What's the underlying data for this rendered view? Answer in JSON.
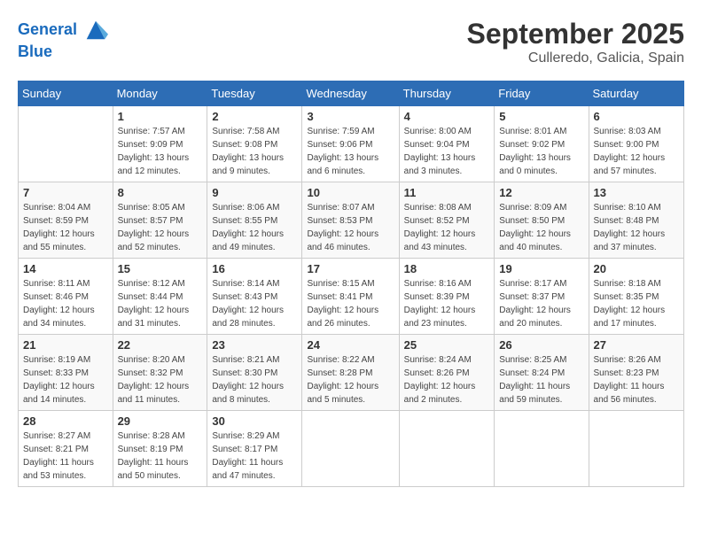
{
  "header": {
    "logo_line1": "General",
    "logo_line2": "Blue",
    "month": "September 2025",
    "location": "Culleredo, Galicia, Spain"
  },
  "weekdays": [
    "Sunday",
    "Monday",
    "Tuesday",
    "Wednesday",
    "Thursday",
    "Friday",
    "Saturday"
  ],
  "weeks": [
    [
      {
        "day": null,
        "info": null
      },
      {
        "day": "1",
        "info": "Sunrise: 7:57 AM\nSunset: 9:09 PM\nDaylight: 13 hours\nand 12 minutes."
      },
      {
        "day": "2",
        "info": "Sunrise: 7:58 AM\nSunset: 9:08 PM\nDaylight: 13 hours\nand 9 minutes."
      },
      {
        "day": "3",
        "info": "Sunrise: 7:59 AM\nSunset: 9:06 PM\nDaylight: 13 hours\nand 6 minutes."
      },
      {
        "day": "4",
        "info": "Sunrise: 8:00 AM\nSunset: 9:04 PM\nDaylight: 13 hours\nand 3 minutes."
      },
      {
        "day": "5",
        "info": "Sunrise: 8:01 AM\nSunset: 9:02 PM\nDaylight: 13 hours\nand 0 minutes."
      },
      {
        "day": "6",
        "info": "Sunrise: 8:03 AM\nSunset: 9:00 PM\nDaylight: 12 hours\nand 57 minutes."
      }
    ],
    [
      {
        "day": "7",
        "info": "Sunrise: 8:04 AM\nSunset: 8:59 PM\nDaylight: 12 hours\nand 55 minutes."
      },
      {
        "day": "8",
        "info": "Sunrise: 8:05 AM\nSunset: 8:57 PM\nDaylight: 12 hours\nand 52 minutes."
      },
      {
        "day": "9",
        "info": "Sunrise: 8:06 AM\nSunset: 8:55 PM\nDaylight: 12 hours\nand 49 minutes."
      },
      {
        "day": "10",
        "info": "Sunrise: 8:07 AM\nSunset: 8:53 PM\nDaylight: 12 hours\nand 46 minutes."
      },
      {
        "day": "11",
        "info": "Sunrise: 8:08 AM\nSunset: 8:52 PM\nDaylight: 12 hours\nand 43 minutes."
      },
      {
        "day": "12",
        "info": "Sunrise: 8:09 AM\nSunset: 8:50 PM\nDaylight: 12 hours\nand 40 minutes."
      },
      {
        "day": "13",
        "info": "Sunrise: 8:10 AM\nSunset: 8:48 PM\nDaylight: 12 hours\nand 37 minutes."
      }
    ],
    [
      {
        "day": "14",
        "info": "Sunrise: 8:11 AM\nSunset: 8:46 PM\nDaylight: 12 hours\nand 34 minutes."
      },
      {
        "day": "15",
        "info": "Sunrise: 8:12 AM\nSunset: 8:44 PM\nDaylight: 12 hours\nand 31 minutes."
      },
      {
        "day": "16",
        "info": "Sunrise: 8:14 AM\nSunset: 8:43 PM\nDaylight: 12 hours\nand 28 minutes."
      },
      {
        "day": "17",
        "info": "Sunrise: 8:15 AM\nSunset: 8:41 PM\nDaylight: 12 hours\nand 26 minutes."
      },
      {
        "day": "18",
        "info": "Sunrise: 8:16 AM\nSunset: 8:39 PM\nDaylight: 12 hours\nand 23 minutes."
      },
      {
        "day": "19",
        "info": "Sunrise: 8:17 AM\nSunset: 8:37 PM\nDaylight: 12 hours\nand 20 minutes."
      },
      {
        "day": "20",
        "info": "Sunrise: 8:18 AM\nSunset: 8:35 PM\nDaylight: 12 hours\nand 17 minutes."
      }
    ],
    [
      {
        "day": "21",
        "info": "Sunrise: 8:19 AM\nSunset: 8:33 PM\nDaylight: 12 hours\nand 14 minutes."
      },
      {
        "day": "22",
        "info": "Sunrise: 8:20 AM\nSunset: 8:32 PM\nDaylight: 12 hours\nand 11 minutes."
      },
      {
        "day": "23",
        "info": "Sunrise: 8:21 AM\nSunset: 8:30 PM\nDaylight: 12 hours\nand 8 minutes."
      },
      {
        "day": "24",
        "info": "Sunrise: 8:22 AM\nSunset: 8:28 PM\nDaylight: 12 hours\nand 5 minutes."
      },
      {
        "day": "25",
        "info": "Sunrise: 8:24 AM\nSunset: 8:26 PM\nDaylight: 12 hours\nand 2 minutes."
      },
      {
        "day": "26",
        "info": "Sunrise: 8:25 AM\nSunset: 8:24 PM\nDaylight: 11 hours\nand 59 minutes."
      },
      {
        "day": "27",
        "info": "Sunrise: 8:26 AM\nSunset: 8:23 PM\nDaylight: 11 hours\nand 56 minutes."
      }
    ],
    [
      {
        "day": "28",
        "info": "Sunrise: 8:27 AM\nSunset: 8:21 PM\nDaylight: 11 hours\nand 53 minutes."
      },
      {
        "day": "29",
        "info": "Sunrise: 8:28 AM\nSunset: 8:19 PM\nDaylight: 11 hours\nand 50 minutes."
      },
      {
        "day": "30",
        "info": "Sunrise: 8:29 AM\nSunset: 8:17 PM\nDaylight: 11 hours\nand 47 minutes."
      },
      {
        "day": null,
        "info": null
      },
      {
        "day": null,
        "info": null
      },
      {
        "day": null,
        "info": null
      },
      {
        "day": null,
        "info": null
      }
    ]
  ]
}
